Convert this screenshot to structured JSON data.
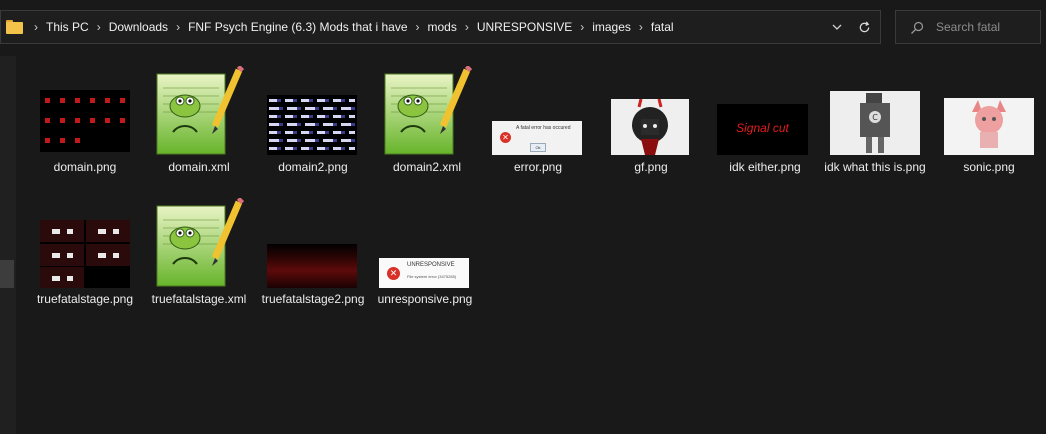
{
  "address": {
    "crumbs": [
      "This PC",
      "Downloads",
      "FNF Psych Engine (6.3) Mods that i have",
      "mods",
      "UNRESPONSIVE",
      "images",
      "fatal"
    ],
    "separator": "›"
  },
  "search": {
    "placeholder": "Search fatal"
  },
  "files": [
    {
      "name": "domain.png"
    },
    {
      "name": "domain.xml"
    },
    {
      "name": "domain2.png"
    },
    {
      "name": "domain2.xml"
    },
    {
      "name": "error.png",
      "thumb_text": "A fatal error has occured",
      "thumb_button": "Ok"
    },
    {
      "name": "gf.png"
    },
    {
      "name": "idk either.png",
      "thumb_text": "Signal cut"
    },
    {
      "name": "idk what this is.png"
    },
    {
      "name": "sonic.png"
    },
    {
      "name": "truefatalstage.png"
    },
    {
      "name": "truefatalstage.xml"
    },
    {
      "name": "truefatalstage2.png"
    },
    {
      "name": "unresponsive.png",
      "thumb_title": "UNRESPONSIVE",
      "thumb_text": "File system error (3475285)"
    }
  ],
  "colors": {
    "background": "#191919",
    "folder": "#f3c24a",
    "accent_red": "#d93027"
  }
}
